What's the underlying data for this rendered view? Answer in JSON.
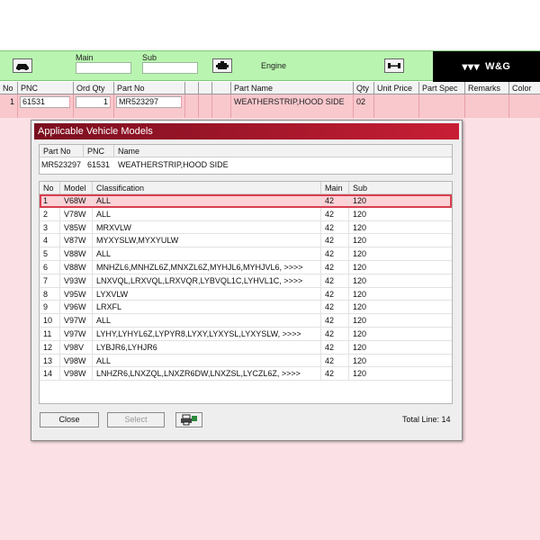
{
  "toolbar": {
    "main_label": "Main",
    "sub_label": "Sub",
    "engine_label": "Engine",
    "brand": "W&G"
  },
  "grid": {
    "columns": [
      "No",
      "PNC",
      "Ord Qty",
      "Part No",
      "",
      "",
      "",
      "Part Name",
      "Qty",
      "Unit Price",
      "Part Spec",
      "Remarks",
      "Color"
    ],
    "row": {
      "no": "1",
      "pnc": "61531",
      "ord_qty": "1",
      "part_no": "MR523297",
      "part_name": "WEATHERSTRIP,HOOD SIDE",
      "qty": "02"
    }
  },
  "dialog": {
    "title": "Applicable Vehicle Models",
    "info_headers": [
      "Part No",
      "PNC",
      "Name"
    ],
    "info_values": [
      "MR523297",
      "61531",
      "WEATHERSTRIP,HOOD SIDE"
    ],
    "model_headers": [
      "No",
      "Model",
      "Classification",
      "Main",
      "Sub"
    ],
    "models": [
      {
        "no": "1",
        "model": "V68W",
        "classification": "ALL",
        "main": "42",
        "sub": "120"
      },
      {
        "no": "2",
        "model": "V78W",
        "classification": "ALL",
        "main": "42",
        "sub": "120"
      },
      {
        "no": "3",
        "model": "V85W",
        "classification": "MRXVLW",
        "main": "42",
        "sub": "120"
      },
      {
        "no": "4",
        "model": "V87W",
        "classification": "MYXYSLW,MYXYULW",
        "main": "42",
        "sub": "120"
      },
      {
        "no": "5",
        "model": "V88W",
        "classification": "ALL",
        "main": "42",
        "sub": "120"
      },
      {
        "no": "6",
        "model": "V88W",
        "classification": "MNHZL6,MNHZL6Z,MNXZL6Z,MYHJL6,MYHJVL6,  >>>>",
        "main": "42",
        "sub": "120"
      },
      {
        "no": "7",
        "model": "V93W",
        "classification": "LNXVQL,LRXVQL,LRXVQR,LYBVQL1C,LYHVL1C,  >>>>",
        "main": "42",
        "sub": "120"
      },
      {
        "no": "8",
        "model": "V95W",
        "classification": "LYXVLW",
        "main": "42",
        "sub": "120"
      },
      {
        "no": "9",
        "model": "V96W",
        "classification": "LRXFL",
        "main": "42",
        "sub": "120"
      },
      {
        "no": "10",
        "model": "V97W",
        "classification": "ALL",
        "main": "42",
        "sub": "120"
      },
      {
        "no": "11",
        "model": "V97W",
        "classification": "LYHY,LYHYL6Z,LYPYR8,LYXY,LYXYSL,LYXYSLW,  >>>>",
        "main": "42",
        "sub": "120"
      },
      {
        "no": "12",
        "model": "V98V",
        "classification": "LYBJR6,LYHJR6",
        "main": "42",
        "sub": "120"
      },
      {
        "no": "13",
        "model": "V98W",
        "classification": "ALL",
        "main": "42",
        "sub": "120"
      },
      {
        "no": "14",
        "model": "V98W",
        "classification": "LNHZR6,LNXZQL,LNXZR6DW,LNXZSL,LYCZL6Z,  >>>>",
        "main": "42",
        "sub": "120"
      }
    ],
    "close_label": "Close",
    "select_label": "Select",
    "total_line": "Total Line: 14"
  },
  "icons": {
    "car": "car-icon",
    "engine": "engine-icon",
    "axle": "axle-icon",
    "print": "printer-icon"
  }
}
